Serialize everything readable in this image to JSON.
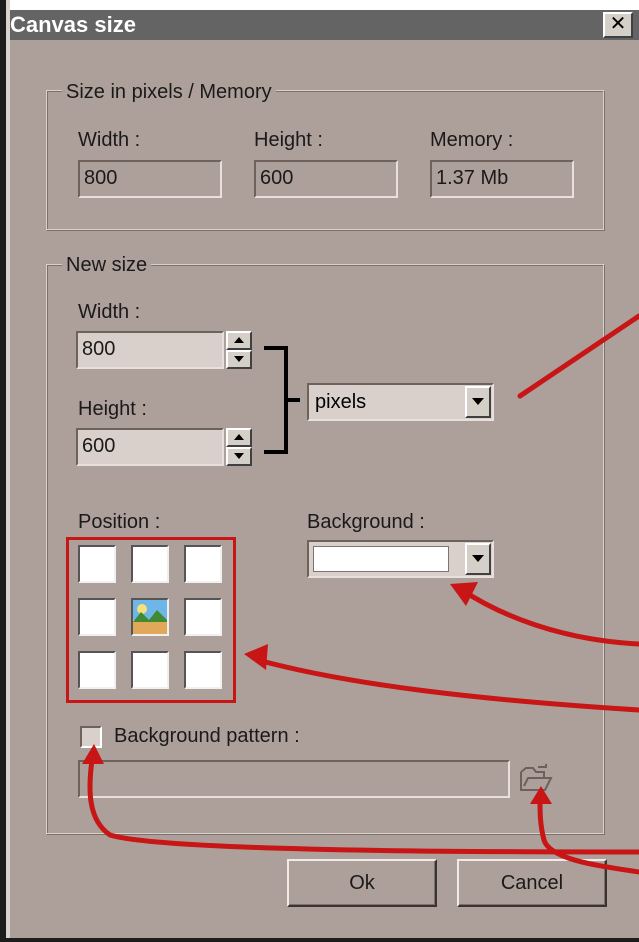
{
  "dialog": {
    "title": "Canvas size",
    "close_glyph": "✕"
  },
  "size_group": {
    "label": "Size in pixels / Memory",
    "width_label": "Width :",
    "width_value": "800",
    "height_label": "Height :",
    "height_value": "600",
    "memory_label": "Memory :",
    "memory_value": "1.37 Mb"
  },
  "new_size_group": {
    "label": "New size",
    "width_label": "Width :",
    "width_value": "800",
    "height_label": "Height :",
    "height_value": "600",
    "unit_value": "pixels",
    "position_label": "Position :",
    "background_label": "Background :",
    "background_color": "#ffffff",
    "background_pattern_label": "Background pattern :",
    "background_pattern_checked": false,
    "background_pattern_path": ""
  },
  "buttons": {
    "ok_label": "Ok",
    "cancel_label": "Cancel"
  },
  "colors": {
    "dialog_bg": "#ada09a",
    "title_bar": "#646464",
    "annotation": "#c81515"
  },
  "icons": {
    "close": "close-icon",
    "spin_up": "arrow-up-icon",
    "spin_down": "arrow-down-icon",
    "dropdown": "chevron-down-icon",
    "center_image": "landscape-image-icon",
    "browse": "folder-open-icon"
  }
}
